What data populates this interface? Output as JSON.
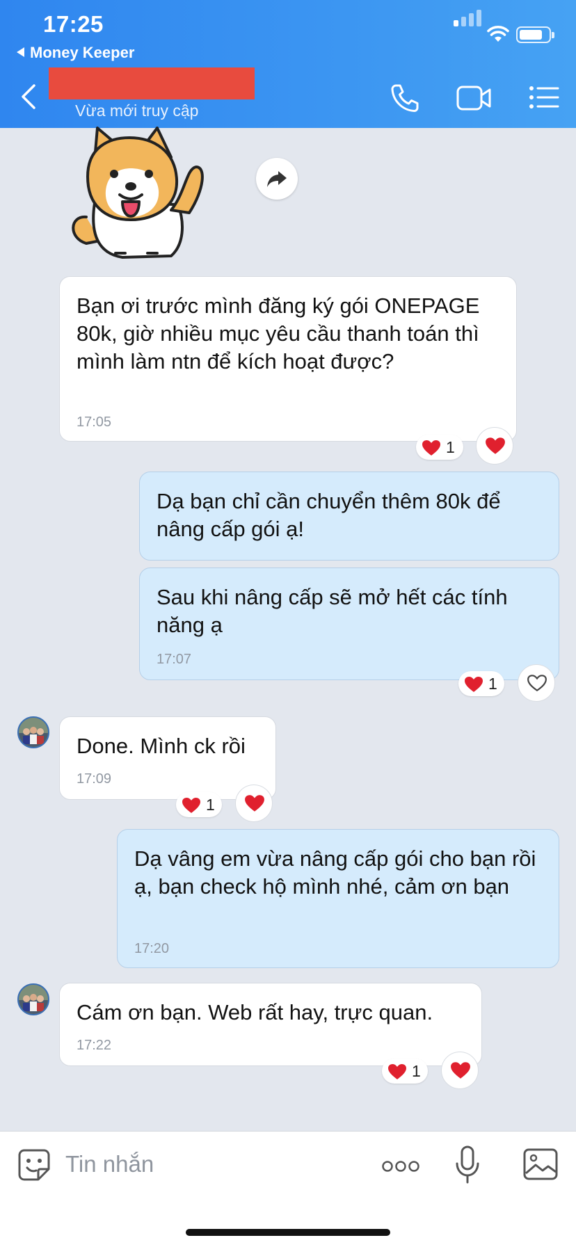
{
  "status_bar": {
    "time": "17:25",
    "back_app": "Money Keeper"
  },
  "header": {
    "subtitle": "Vừa mới truy cập",
    "icons": [
      "back-chevron-icon",
      "phone-icon",
      "video-call-icon",
      "menu-list-icon"
    ],
    "redaction_color": "#e84b3e"
  },
  "messages": [
    {
      "side": "in",
      "text": "Bạn ơi trước mình đăng ký gói ONEPAGE 80k, giờ nhiều mục yêu cầu thanh toán thì mình làm ntn để kích hoạt được?",
      "time": "17:05",
      "reaction_count": "1",
      "reacted": true
    },
    {
      "side": "out",
      "text": "Dạ bạn chỉ cần chuyển thêm 80k để nâng cấp gói ạ!",
      "time": "",
      "reaction_count": "",
      "reacted": false
    },
    {
      "side": "out",
      "text": "Sau khi nâng cấp sẽ mở hết các tính năng ạ",
      "time": "17:07",
      "reaction_count": "1",
      "reacted": false
    },
    {
      "side": "in",
      "text": "Done. Mình ck rồi",
      "time": "17:09",
      "reaction_count": "1",
      "reacted": true
    },
    {
      "side": "out",
      "text": "Dạ vâng em vừa nâng cấp gói cho bạn rồi ạ, bạn check hộ mình nhé, cảm ơn bạn",
      "time": "17:20",
      "reaction_count": "",
      "reacted": false
    },
    {
      "side": "in",
      "text": "Cám ơn bạn. Web rất hay, trực quan.",
      "time": "17:22",
      "reaction_count": "1",
      "reacted": true
    }
  ],
  "composer": {
    "placeholder": "Tin nhắn",
    "icons": [
      "sticker-smile-icon",
      "more-dots-icon",
      "microphone-icon",
      "image-gallery-icon"
    ]
  },
  "colors": {
    "header": "#3c96f2",
    "background": "#e3e7ee",
    "outgoing_bubble": "#d5ebfc",
    "incoming_bubble": "#ffffff",
    "heart": "#e0202e"
  }
}
